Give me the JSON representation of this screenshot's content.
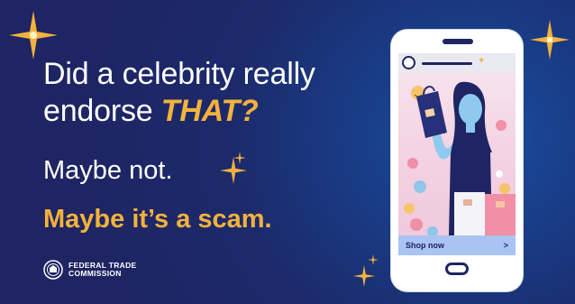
{
  "headline": {
    "line1": "Did a celebrity really",
    "line2_prefix": "endorse ",
    "line2_highlight": "THAT?"
  },
  "subline1": "Maybe not.",
  "subline2": "Maybe it’s a scam.",
  "ftc": {
    "line1": "FEDERAL TRADE",
    "line2": "COMMISSION"
  },
  "phone": {
    "cta_label": "Shop now",
    "cta_arrow": ">"
  },
  "colors": {
    "background": "#1f2463",
    "accent": "#f3b23c",
    "text": "#ffffff",
    "cta_bar": "#a9c3f2"
  },
  "icons": [
    "sparkle-star-icon",
    "ftc-seal-icon",
    "user-avatar-icon",
    "smiley-emoji-icon",
    "heart-emoji-icon",
    "shopping-bag-icon",
    "gift-box-icon"
  ]
}
